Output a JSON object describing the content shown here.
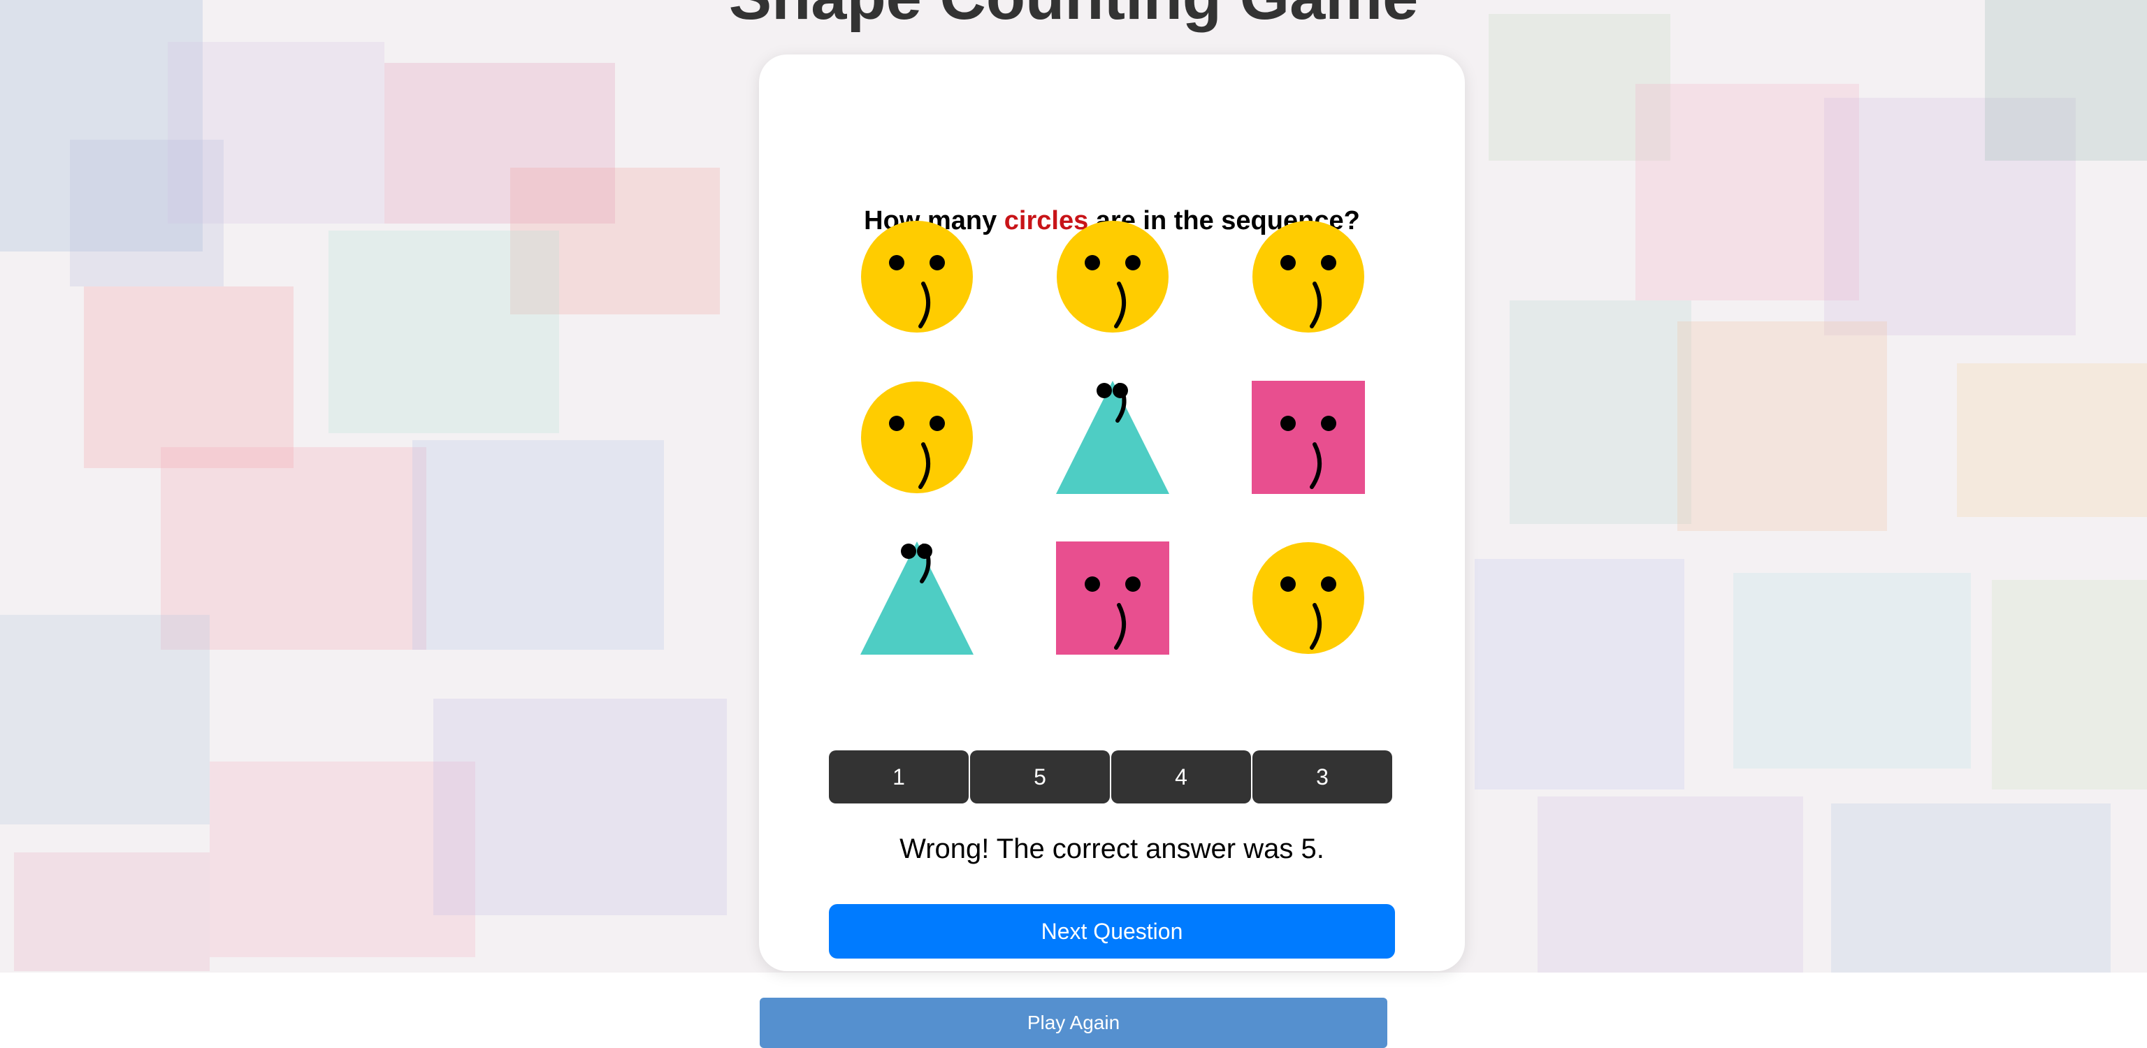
{
  "page": {
    "title": "Shape Counting Game"
  },
  "question": {
    "prefix": "How many ",
    "target": "circles",
    "suffix": " are in the sequence?"
  },
  "shapes": [
    {
      "type": "circle",
      "color": "#ffcc00"
    },
    {
      "type": "circle",
      "color": "#ffcc00"
    },
    {
      "type": "circle",
      "color": "#ffcc00"
    },
    {
      "type": "circle",
      "color": "#ffcc00"
    },
    {
      "type": "triangle",
      "color": "#4ecdc4"
    },
    {
      "type": "square",
      "color": "#e84f8f"
    },
    {
      "type": "triangle",
      "color": "#4ecdc4"
    },
    {
      "type": "square",
      "color": "#e84f8f"
    },
    {
      "type": "circle",
      "color": "#ffcc00"
    }
  ],
  "answers": [
    "1",
    "5",
    "4",
    "3"
  ],
  "feedback": "Wrong! The correct answer was 5.",
  "buttons": {
    "next": "Next Question",
    "play_again": "Play Again"
  },
  "colors": {
    "target_word": "#c81418",
    "answer_button": "#333333",
    "next_button": "#007bff",
    "play_again_button": "#5590cf"
  }
}
